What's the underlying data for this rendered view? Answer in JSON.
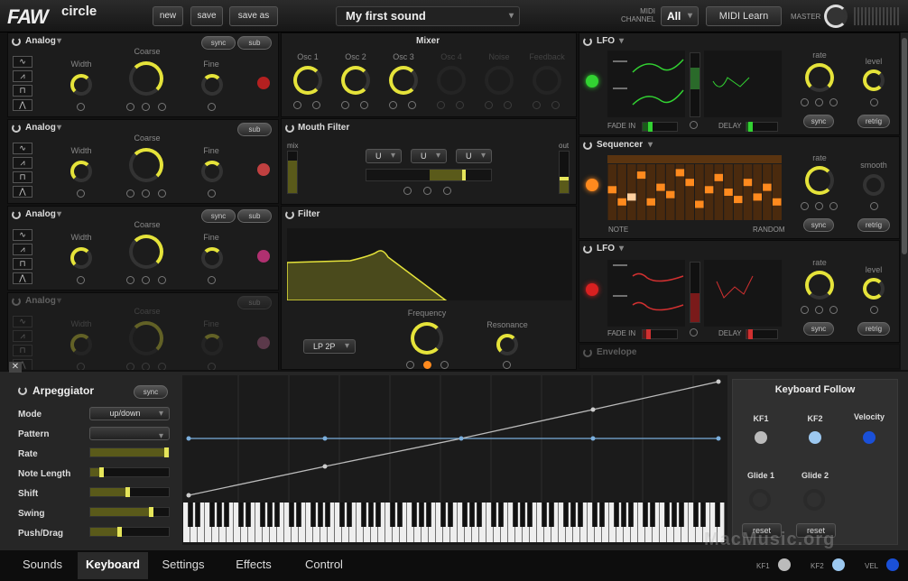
{
  "app": {
    "logo": "FAW",
    "name": "circle"
  },
  "toolbar": {
    "new": "new",
    "save": "save",
    "save_as": "save as",
    "preset": "My first sound",
    "midi_channel_label": "MIDI CHANNEL",
    "midi_channel": "All",
    "midi_learn": "MIDI Learn",
    "master": "MASTER"
  },
  "osc": [
    {
      "title": "Analog",
      "width": "Width",
      "coarse": "Coarse",
      "fine": "Fine",
      "sync": "sync",
      "sub": "sub",
      "led": "#b42020"
    },
    {
      "title": "Analog",
      "width": "Width",
      "coarse": "Coarse",
      "fine": "Fine",
      "sub": "sub",
      "led": "#c04040"
    },
    {
      "title": "Analog",
      "width": "Width",
      "coarse": "Coarse",
      "fine": "Fine",
      "sync": "sync",
      "sub": "sub",
      "led": "#b03070"
    },
    {
      "title": "Analog",
      "width": "Width",
      "coarse": "Coarse",
      "fine": "Fine",
      "sub": "sub",
      "led": "#d070a0"
    }
  ],
  "mixer": {
    "title": "Mixer",
    "labels": [
      "Osc 1",
      "Osc 2",
      "Osc 3",
      "Osc 4",
      "Noise",
      "Feedback"
    ]
  },
  "mouth": {
    "title": "Mouth Filter",
    "mix": "mix",
    "out": "out",
    "selects": [
      "U",
      "U",
      "U"
    ]
  },
  "filter": {
    "title": "Filter",
    "type": "LP 2P",
    "frequency": "Frequency",
    "resonance": "Resonance"
  },
  "lfo1": {
    "title": "LFO",
    "fade_in": "FADE IN",
    "delay": "DELAY",
    "rate": "rate",
    "level": "level",
    "sync": "sync",
    "retrig": "retrig"
  },
  "seq": {
    "title": "Sequencer",
    "note": "NOTE",
    "random": "RANDOM",
    "rate": "rate",
    "smooth": "smooth",
    "sync": "sync",
    "retrig": "retrig",
    "bars": [
      0.55,
      0.3,
      0.4,
      0.85,
      0.3,
      0.6,
      0.45,
      0.9,
      0.7,
      0.25,
      0.55,
      0.8,
      0.5,
      0.35,
      0.7,
      0.4,
      0.6,
      0.3
    ]
  },
  "lfo2": {
    "title": "LFO",
    "fade_in": "FADE IN",
    "delay": "DELAY",
    "rate": "rate",
    "level": "level",
    "sync": "sync",
    "retrig": "retrig"
  },
  "envelope": {
    "title": "Envelope"
  },
  "arp": {
    "title": "Arpeggiator",
    "sync": "sync",
    "mode_label": "Mode",
    "mode": "up/down",
    "pattern_label": "Pattern",
    "rate": "Rate",
    "note_length": "Note Length",
    "shift": "Shift",
    "swing": "Swing",
    "push": "Push/Drag",
    "sliders": {
      "rate": 0.98,
      "note_length": 0.12,
      "shift": 0.45,
      "swing": 0.75,
      "push": 0.35
    }
  },
  "kf": {
    "title": "Keyboard Follow",
    "kf1": "KF1",
    "kf2": "KF2",
    "velocity": "Velocity",
    "glide1": "Glide 1",
    "glide2": "Glide 2",
    "reset": "reset"
  },
  "tabs": [
    "Sounds",
    "Keyboard",
    "Settings",
    "Effects",
    "Control"
  ],
  "status": {
    "kf1": "KF1",
    "kf2": "KF2",
    "vel": "VEL"
  },
  "watermark": "MacMusic.org",
  "colors": {
    "accent": "#e5e33a",
    "seq": "#ff8a1e",
    "lfo": "#d03030"
  }
}
